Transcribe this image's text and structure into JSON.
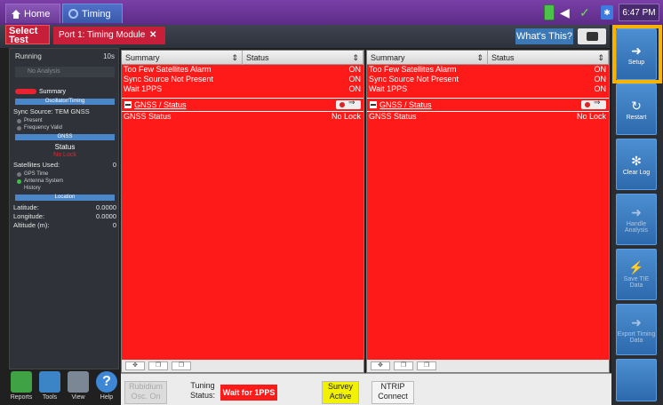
{
  "topbar": {
    "home_tab": "Home",
    "timing_tab": "Timing",
    "time": "6:47 PM",
    "icons": [
      "battery-icon",
      "volume-icon",
      "network-check-icon",
      "bluetooth-icon"
    ]
  },
  "header": {
    "select_test": "Select Test",
    "port_tab": "Port 1: Timing Module",
    "close_glyph": "✕",
    "whats_this": "What's This?",
    "camera_icon": "camera-icon"
  },
  "left_panel": {
    "run_state": "Running",
    "run_time": "10s",
    "button_label": "No Analysis",
    "summary": "Summary",
    "osc_section": "Oscillator/Timing",
    "sync_source_label": "Sync Source:",
    "sync_source_value": "TEM GNSS",
    "present": "Present",
    "frequency_valid": "Frequency Valid",
    "gnss_section": "GNSS",
    "status_label": "Status",
    "status_value": "No Lock",
    "satellites_label": "Satellites Used:",
    "satellites_value": "0",
    "gps_time": "GPS Time",
    "antenna_system": "Antenna System",
    "history": "History",
    "location_section": "Location",
    "latitude_label": "Latitude:",
    "latitude_value": "0.0000",
    "longitude_label": "Longitude:",
    "longitude_value": "0.0000",
    "altitude_label": "Altitude (m):",
    "altitude_value": "0"
  },
  "bottom_tools": {
    "reports": "Reports",
    "tools": "Tools",
    "view": "View",
    "help": "Help"
  },
  "panes": {
    "left": {
      "col_a": "Summary",
      "col_b": "Status",
      "rows": [
        {
          "label": "Too Few Satellites Alarm",
          "value": "ON"
        },
        {
          "label": "Sync Source Not Present",
          "value": "ON"
        },
        {
          "label": "Wait 1PPS",
          "value": "ON"
        }
      ],
      "sub_title": "GNSS / Status",
      "sub_rows": [
        {
          "label": "GNSS Status",
          "value": "No Lock"
        }
      ]
    },
    "right": {
      "col_a": "Summary",
      "col_b": "Status",
      "rows": [
        {
          "label": "Too Few Satellites Alarm",
          "value": "ON"
        },
        {
          "label": "Sync Source Not Present",
          "value": "ON"
        },
        {
          "label": "Wait 1PPS",
          "value": "ON"
        }
      ],
      "sub_title": "GNSS / Status",
      "sub_rows": [
        {
          "label": "GNSS Status",
          "value": "No Lock"
        }
      ]
    }
  },
  "rail": {
    "setup": "Setup",
    "restart": "Restart",
    "clear_log": "Clear Log",
    "handle_analysis": "Handle Analysis",
    "save_tie_data": "Save TIE Data",
    "export_timing_data": "Export Timing Data"
  },
  "bottom_bar": {
    "rubidium": "Rubidium Osc. On",
    "tuning_status": "Tuning Status:",
    "wait": "Wait for 1PPS",
    "survey": "Survey Active",
    "ntrip": "NTRIP Connect"
  },
  "colors": {
    "alarm_red": "#ff1a1a",
    "accent_purple": "#6a3b95",
    "rail_blue": "#3b7cc0",
    "highlight": "#f6b400"
  }
}
